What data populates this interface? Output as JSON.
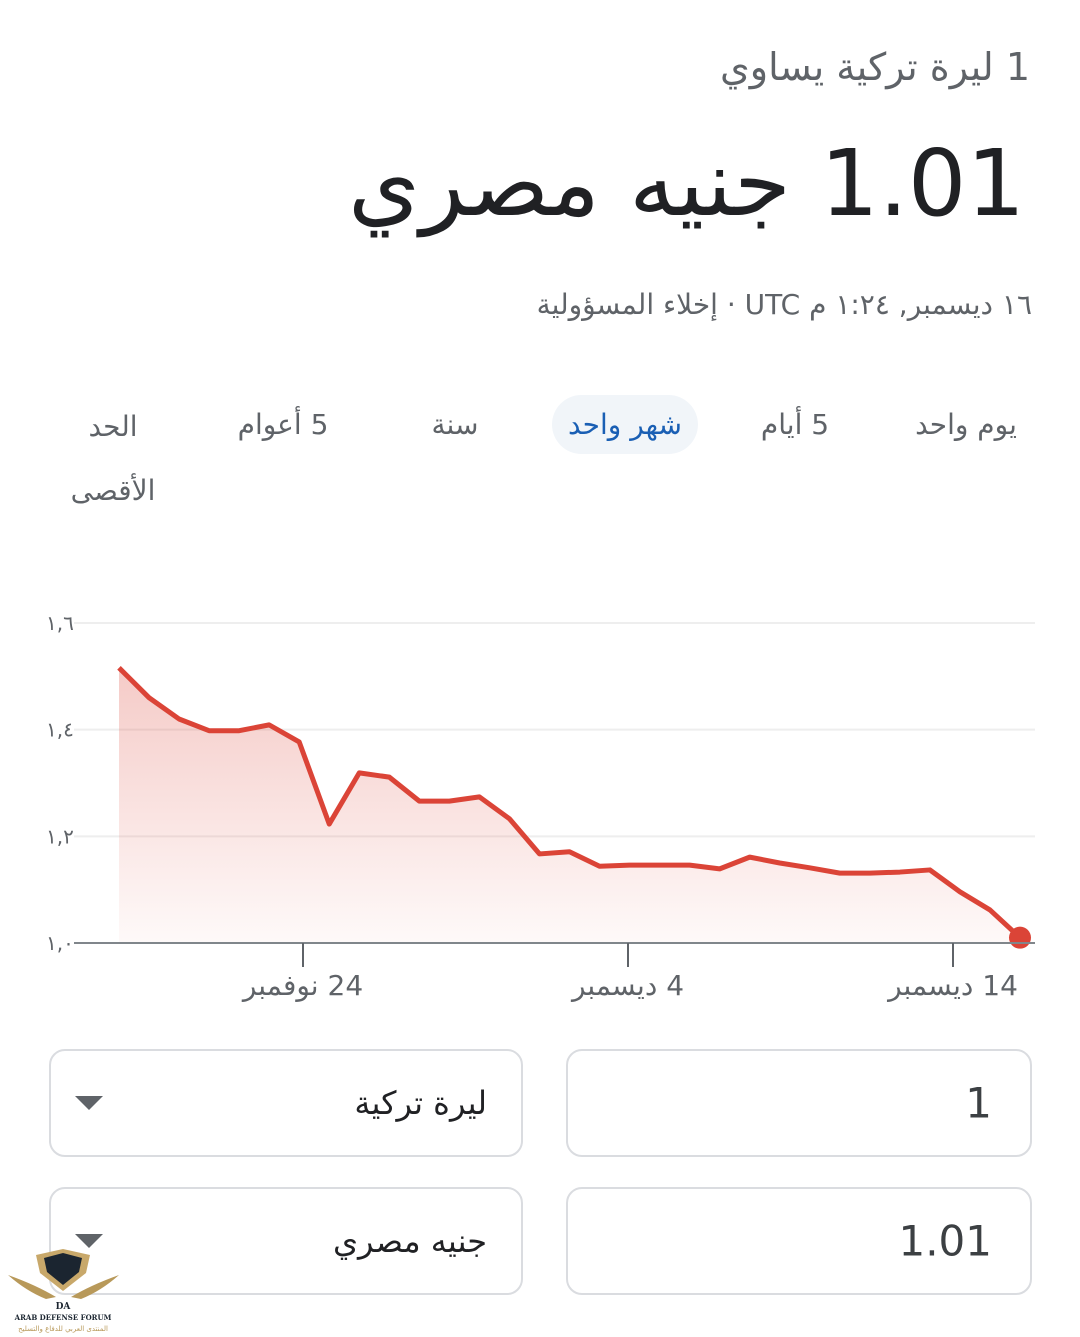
{
  "header": {
    "subtitle": "1 ليرة تركية يساوي",
    "result": "1.01 جنيه مصري",
    "timestamp": "١٦ ديسمبر, ١:٢٤ م UTC · ",
    "disclaimer_link": "إخلاء المسؤولية"
  },
  "tabs": [
    {
      "label": "يوم واحد",
      "active": false
    },
    {
      "label": "5 أيام",
      "active": false
    },
    {
      "label": "شهر واحد",
      "active": true
    },
    {
      "label": "سنة",
      "active": false
    },
    {
      "label": "5 أعوام",
      "active": false
    },
    {
      "label": "الحد الأقصى",
      "active": false
    }
  ],
  "colors": {
    "line": "#db4437",
    "active_tab": "#1a5fb4",
    "active_tab_bg": "#f1f5f9"
  },
  "chart_data": {
    "type": "area",
    "x_range": [
      "18 نوفمبر",
      "16 ديسمبر"
    ],
    "x_ticks": [
      "24 نوفمبر",
      "4 ديسمبر",
      "14 ديسمبر"
    ],
    "y_ticks": [
      "١,٠",
      "١,٢",
      "١,٤",
      "١,٦"
    ],
    "y_tick_values": [
      1.0,
      1.2,
      1.4,
      1.6
    ],
    "ylim": [
      1.0,
      1.6
    ],
    "grid": true,
    "values": [
      1.516,
      1.46,
      1.42,
      1.398,
      1.398,
      1.409,
      1.377,
      1.223,
      1.319,
      1.311,
      1.266,
      1.266,
      1.274,
      1.233,
      1.167,
      1.171,
      1.144,
      1.146,
      1.146,
      1.146,
      1.139,
      1.161,
      1.15,
      1.141,
      1.131,
      1.131,
      1.133,
      1.137,
      1.096,
      1.062,
      1.01
    ]
  },
  "converter": {
    "from_amount": "1",
    "from_currency": "ليرة تركية",
    "to_amount": "1.01",
    "to_currency": "جنيه مصري"
  },
  "watermark": {
    "text_en": "ARAB DEFENSE FORUM",
    "text_ar": "المنتدى العربي للدفاع والتسليح",
    "mark": "DA"
  }
}
